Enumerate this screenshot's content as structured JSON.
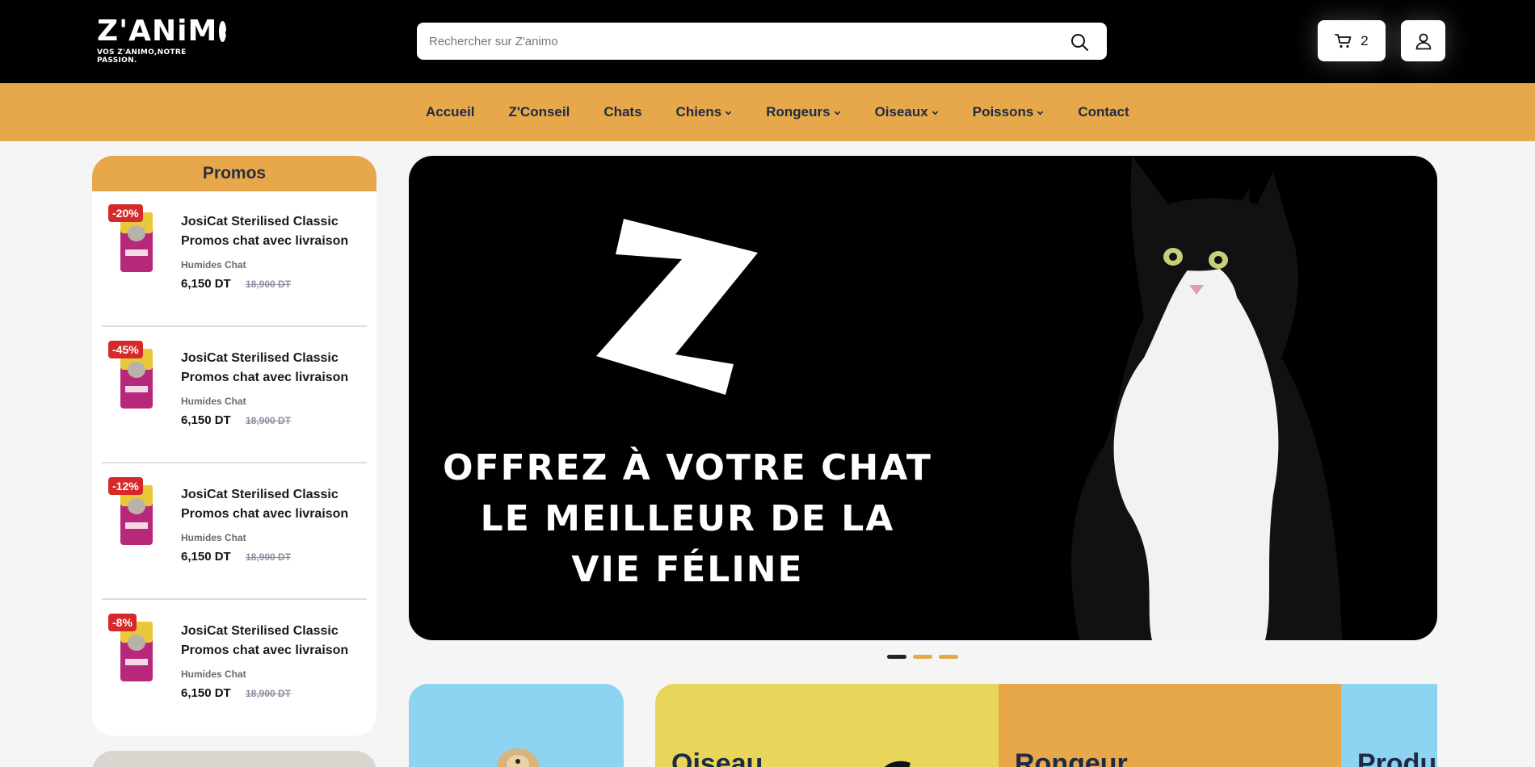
{
  "header": {
    "logo_word": "Z'ANiM",
    "logo_tagline": "VOS Z'ANIMO,NOTRE PASSION.",
    "search_placeholder": "Rechercher sur Z'animo",
    "cart_count": "2"
  },
  "nav": {
    "items": [
      {
        "label": "Accueil",
        "dropdown": false
      },
      {
        "label": "Z'Conseil",
        "dropdown": false
      },
      {
        "label": "Chats",
        "dropdown": false
      },
      {
        "label": "Chiens",
        "dropdown": true
      },
      {
        "label": "Rongeurs",
        "dropdown": true
      },
      {
        "label": "Oiseaux",
        "dropdown": true
      },
      {
        "label": "Poissons",
        "dropdown": true
      },
      {
        "label": "Contact",
        "dropdown": false
      }
    ]
  },
  "promos": {
    "title": "Promos",
    "items": [
      {
        "badge": "-20%",
        "title": "JosiCat Sterilised Classic Promos chat avec livraison",
        "category": "Humides Chat",
        "price": "6,150 DT",
        "old_price": "18,900 DT"
      },
      {
        "badge": "-45%",
        "title": "JosiCat Sterilised Classic Promos chat avec livraison",
        "category": "Humides Chat",
        "price": "6,150 DT",
        "old_price": "18,900 DT"
      },
      {
        "badge": "-12%",
        "title": "JosiCat Sterilised Classic Promos chat avec livraison",
        "category": "Humides Chat",
        "price": "6,150 DT",
        "old_price": "18,900 DT"
      },
      {
        "badge": "-8%",
        "title": "JosiCat Sterilised Classic Promos chat avec livraison",
        "category": "Humides Chat",
        "price": "6,150 DT",
        "old_price": "18,900 DT"
      }
    ]
  },
  "hero": {
    "headline": "Offrez à votre chat le meilleur de la vie féline",
    "slide_count": 3,
    "active_slide": 1
  },
  "categories": [
    {
      "label": ""
    },
    {
      "label": "Oiseau"
    },
    {
      "label": "Rongeur"
    },
    {
      "label": "Produi"
    }
  ],
  "colors": {
    "brand_orange": "#e6a84a",
    "header_black": "#000000",
    "badge_red": "#d62a2a",
    "sky_blue": "#8dd3f2",
    "yellow": "#e8d65a"
  }
}
